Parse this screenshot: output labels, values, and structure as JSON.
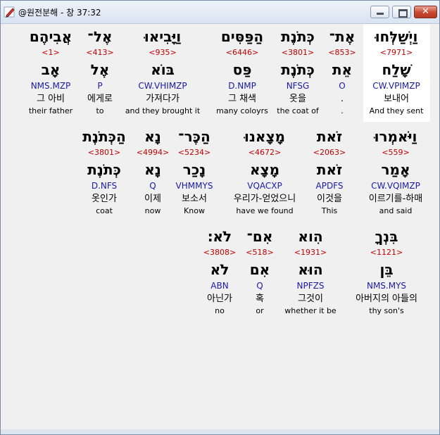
{
  "window": {
    "title": "@원전분해 - 창 37:32"
  },
  "rows": [
    [
      {
        "heb": "וַיְשַׁלְּחוּ",
        "strong": "<7971>",
        "lemma": "שָׁלַח",
        "parse": "CW.VPIMZP",
        "korean": "보내어",
        "english": "And they sent",
        "selected": true
      },
      {
        "heb": "אֶת־",
        "strong": "<853>",
        "lemma": "אֵת",
        "parse": "O",
        "korean": ".",
        "english": ".",
        "selected": false
      },
      {
        "heb": "כְּתֹנֶת",
        "strong": "<3801>",
        "lemma": "כְּתֹנֶת",
        "parse": "NFSG",
        "korean": "옷을",
        "english": "the coat of",
        "selected": false
      },
      {
        "heb": "הַפַּסִּים",
        "strong": "<6446>",
        "lemma": "פַּס",
        "parse": "D.NMP",
        "korean": "그 채색",
        "english": "many coloyrs",
        "selected": false
      },
      {
        "heb": "וַיָּבִיאוּ",
        "strong": "<935>",
        "lemma": "בּוֹא",
        "parse": "CW.VHIMZP",
        "korean": "가져다가",
        "english": "and they brought it",
        "selected": false
      },
      {
        "heb": "אֶל־",
        "strong": "<413>",
        "lemma": "אֶל",
        "parse": "P",
        "korean": "에게로",
        "english": "to",
        "selected": false
      },
      {
        "heb": "אֲבִיהֶם",
        "strong": "<1>",
        "lemma": "אָב",
        "parse": "NMS.MZP",
        "korean": "그 아비",
        "english": "their father",
        "selected": false
      }
    ],
    [
      {
        "heb": "וַיֹּאמְרוּ",
        "strong": "<559>",
        "lemma": "אָמַר",
        "parse": "CW.VQIMZP",
        "korean": "이르기를-하매",
        "english": "and said",
        "selected": false
      },
      {
        "heb": "זֹאת",
        "strong": "<2063>",
        "lemma": "זֹאת",
        "parse": "APDFS",
        "korean": "이것을",
        "english": "This",
        "selected": false
      },
      {
        "heb": "מָצָאנוּ",
        "strong": "<4672>",
        "lemma": "מָצָא",
        "parse": "VQACXP",
        "korean": "우리가-얻었으니",
        "english": "have we found",
        "selected": false
      },
      {
        "heb": "הַכֶּר־",
        "strong": "<5234>",
        "lemma": "נָכַר",
        "parse": "VHMMYS",
        "korean": "보소서",
        "english": "Know",
        "selected": false
      },
      {
        "heb": "נָא",
        "strong": "<4994>",
        "lemma": "נָא",
        "parse": "Q",
        "korean": "이제",
        "english": "now",
        "selected": false
      },
      {
        "heb": "הַכְּתֹנֶת",
        "strong": "<3801>",
        "lemma": "כְּתֹנֶת",
        "parse": "D.NFS",
        "korean": "옷인가",
        "english": "coat",
        "selected": false
      }
    ],
    [
      {
        "heb": "בִּנְךָ",
        "strong": "<1121>",
        "lemma": "בֵּן",
        "parse": "NMS.MYS",
        "korean": "아버지의 아들의",
        "english": "thy son's",
        "selected": false
      },
      {
        "heb": "הִוא",
        "strong": "<1931>",
        "lemma": "הוּא",
        "parse": "NPFZS",
        "korean": "그것이",
        "english": "whether it be",
        "selected": false
      },
      {
        "heb": "אִם־",
        "strong": "<518>",
        "lemma": "אִם",
        "parse": "Q",
        "korean": "혹",
        "english": "or",
        "selected": false
      },
      {
        "heb": "לֹא׃",
        "strong": "<3808>",
        "lemma": "לֹא",
        "parse": "ABN",
        "korean": "아닌가",
        "english": "no",
        "selected": false
      }
    ]
  ]
}
